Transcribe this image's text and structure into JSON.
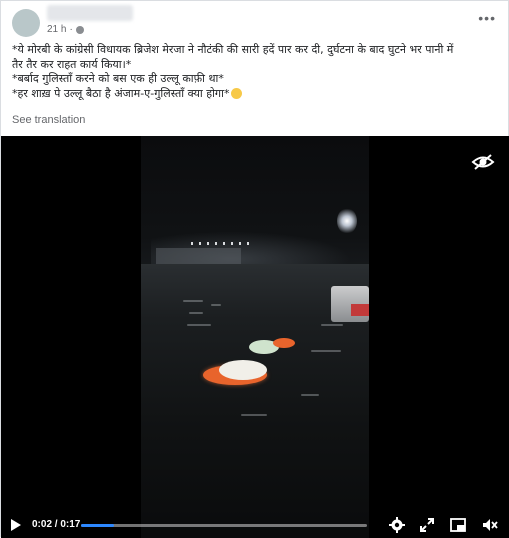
{
  "post": {
    "time": "21 h",
    "separator": "·",
    "privacy_icon": "globe-icon",
    "more_icon": "more-horizontal-icon",
    "lines": [
      "*ये मोरबी के कांग्रेसी विधायक ब्रिजेश मेरजा ने नौटंकी की सारी हदें पार कर दी, दुर्घटना के बाद घुटने भर पानी में",
      "तैर तैर कर राहत कार्य किया।*",
      "*बर्बाद गुलिस्ताँ करने को बस एक ही उल्लू काफ़ी था*",
      "*हर शाख़ पे उल्लू बैठा है अंजाम-ए-गुलिस्ताँ क्या होगा*"
    ],
    "see_translation": "See translation"
  },
  "video": {
    "time_display": "0:02 / 0:17",
    "progress": 0.117,
    "accent": "#2d88ff",
    "icons": [
      "eye-icon",
      "play-icon",
      "settings-icon",
      "fullscreen-icon",
      "pip-icon",
      "mute-icon"
    ]
  }
}
